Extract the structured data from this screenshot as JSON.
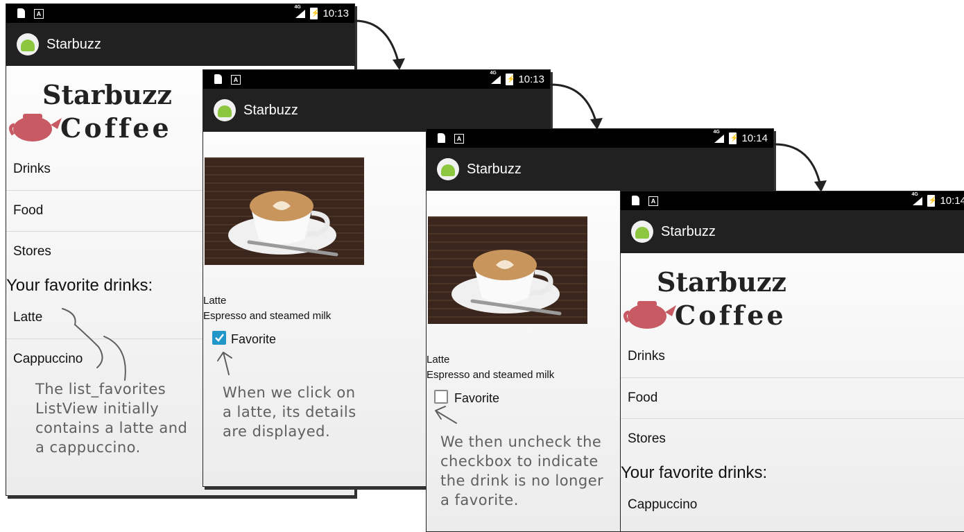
{
  "app": {
    "title": "Starbuzz"
  },
  "screens": [
    {
      "time": "10:13",
      "menu": [
        "Drinks",
        "Food",
        "Stores"
      ],
      "favorites_heading": "Your favorite drinks:",
      "favorites": [
        "Latte",
        "Cappuccino"
      ],
      "annotation": [
        "The list_favorites",
        "ListView initially",
        "contains a latte and",
        "a cappuccino."
      ]
    },
    {
      "time": "10:13",
      "drink_name": "Latte",
      "drink_description": "Espresso and steamed milk",
      "favorite_label": "Favorite",
      "favorite_checked": true,
      "annotation": [
        "When we click on",
        "a latte, its details",
        "are displayed."
      ]
    },
    {
      "time": "10:14",
      "drink_name": "Latte",
      "drink_description": "Espresso and steamed milk",
      "favorite_label": "Favorite",
      "favorite_checked": false,
      "annotation": [
        "We then uncheck the",
        "checkbox to indicate",
        "the drink is no longer",
        "a favorite."
      ]
    },
    {
      "time": "10:14",
      "menu": [
        "Drinks",
        "Food",
        "Stores"
      ],
      "favorites_heading": "Your favorite drinks:",
      "favorites": [
        "Cappuccino"
      ]
    }
  ],
  "logo": {
    "line1": "Starbuzz",
    "line2": "Coffee"
  },
  "colors": {
    "status_bar": "#000000",
    "app_bar": "#212121",
    "android_green": "#8dc63f",
    "checkbox_accent": "#2196c9",
    "teapot": "#c85a64",
    "handwriting": "#5f5f5f"
  },
  "icons": {
    "app": "android-icon",
    "status_left": [
      "sd-card-icon",
      "a-notification-icon"
    ],
    "status_right": [
      "signal-4g-icon",
      "battery-charging-icon"
    ]
  }
}
